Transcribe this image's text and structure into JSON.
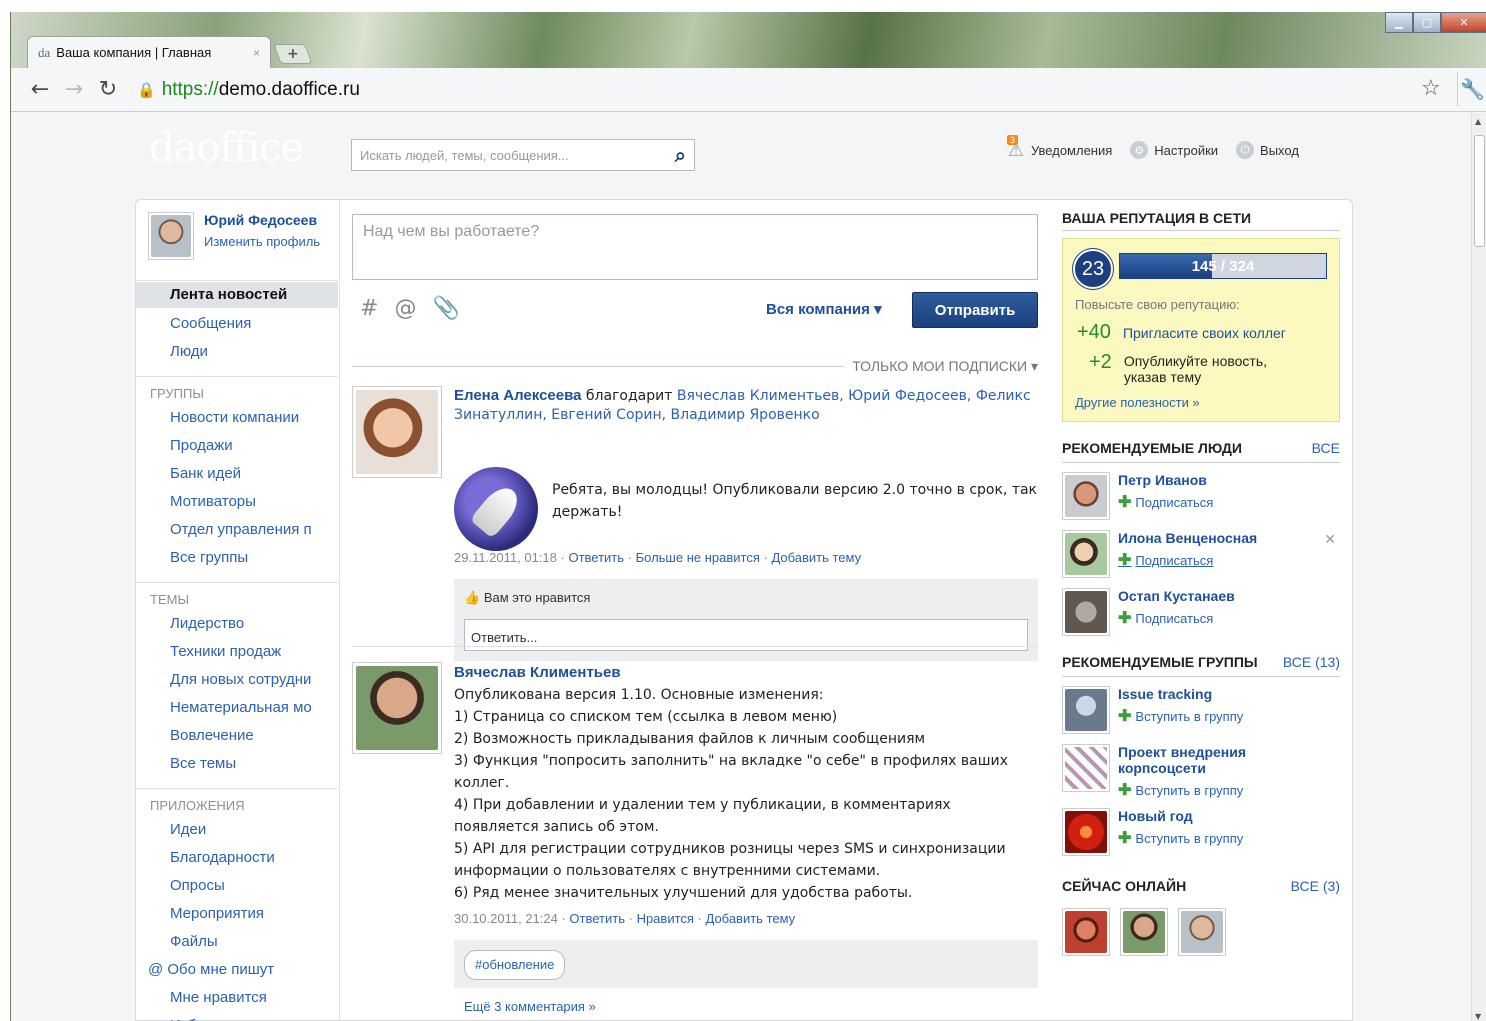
{
  "browser": {
    "tab_favicon": "da",
    "tab_title": "Ваша компания | Главная",
    "tab_close": "×",
    "new_tab": "+",
    "url_scheme": "https://",
    "url_host": "demo.daoffice.ru",
    "window_controls": {
      "minimize": "▁",
      "maximize": "▢",
      "close": "✕"
    }
  },
  "header": {
    "logo": "daoffice",
    "search_placeholder": "Искать людей, темы, сообщения...",
    "notifications_count": "3",
    "notifications_label": "Уведомления",
    "settings_label": "Настройки",
    "logout_label": "Выход"
  },
  "sidebar": {
    "user_name": "Юрий Федосеев",
    "edit_profile": "Изменить профиль",
    "active_item": "Лента новостей",
    "main_items": [
      "Сообщения",
      "Люди"
    ],
    "groups_header": "ГРУППЫ",
    "groups": [
      "Новости компании",
      "Продажи",
      "Банк идей",
      "Мотиваторы",
      "Отдел управления п",
      "Все группы"
    ],
    "topics_header": "ТЕМЫ",
    "topics": [
      "Лидерство",
      "Техники продаж",
      "Для новых сотрудни",
      "Нематериальная мо",
      "Вовлечение",
      "Все темы"
    ],
    "apps_header": "ПРИЛОЖЕНИЯ",
    "apps": [
      "Идеи",
      "Благодарности",
      "Опросы",
      "Мероприятия",
      "Файлы",
      "@ Обо мне пишут",
      "Мне нравится",
      "Избранное"
    ]
  },
  "composer": {
    "placeholder": "Над чем вы работаете?",
    "tools": [
      "#",
      "@",
      "📎"
    ],
    "scope": "Вся компания ▾",
    "send": "Отправить"
  },
  "feed_filter": "ТОЛЬКО МОИ ПОДПИСКИ ▾",
  "posts": [
    {
      "author": "Елена Алексеева",
      "verb": " благодарит ",
      "recipients": "Вячеслав Климентьев, Юрий Федосеев, Феликс Зинатуллин, Евгений Сорин, Владимир Яровенко",
      "text": "Ребята, вы молодцы! Опубликовали версию 2.0 точно в срок, так держать!",
      "date": "29.11.2011, 01:18",
      "actions": [
        "Ответить",
        "Больше не нравится",
        "Добавить тему"
      ],
      "likes": "Вам это нравится",
      "reply_placeholder": "Ответить..."
    },
    {
      "author": "Вячеслав Климентьев",
      "lines": [
        "Опубликована версия 1.10. Основные изменения:",
        "1) Страница со списком тем (ссылка в левом меню)",
        "2) Возможность прикладывания файлов к личным сообщениям",
        "3) Функция \"попросить заполнить\" на вкладке \"о себе\" в профилях ваших коллег.",
        "4) При добавлении и удалении тем у публикации, в комментариях появляется запись об этом.",
        "5) API для регистрации сотрудников розницы через SMS и синхронизации информации о пользователях с внутренними системами.",
        "6) Ряд менее значительных улучшений для удобства работы."
      ],
      "date": "30.10.2011, 21:24",
      "actions": [
        "Ответить",
        "Нравится",
        "Добавить тему"
      ],
      "tag": "#обновление",
      "more_comments": "Ещё 3 комментария »"
    }
  ],
  "reputation": {
    "header": "ВАША РЕПУТАЦИЯ В СЕТИ",
    "level": "23",
    "progress_text": "145 / 324",
    "progress": 0.448,
    "hint": "Повысьте свою репутацию:",
    "items": [
      {
        "points": "+40",
        "text": "Пригласите своих коллег"
      },
      {
        "points": "+2",
        "text": "Опубликуйте новость, указав тему"
      }
    ],
    "more": "Другие полезности »"
  },
  "recommended_people": {
    "header": "РЕКОМЕНДУЕМЫЕ ЛЮДИ",
    "all": "ВСЕ",
    "action": "Подписаться",
    "people": [
      "Петр Иванов",
      "Илона Венценосная",
      "Остап Кустанаев"
    ]
  },
  "recommended_groups": {
    "header": "РЕКОМЕНДУЕМЫЕ ГРУППЫ",
    "all": "ВСЕ (13)",
    "action": "Вступить в группу",
    "groups": [
      "Issue tracking",
      "Проект внедрения корпсоцсети",
      "Новый год"
    ]
  },
  "online": {
    "header": "СЕЙЧАС ОНЛАЙН",
    "all": "ВСЕ (3)"
  },
  "colors": {
    "link": "#2a62b0",
    "brand_blue": "#1c4080",
    "rep_bg": "#fbf8c0"
  }
}
